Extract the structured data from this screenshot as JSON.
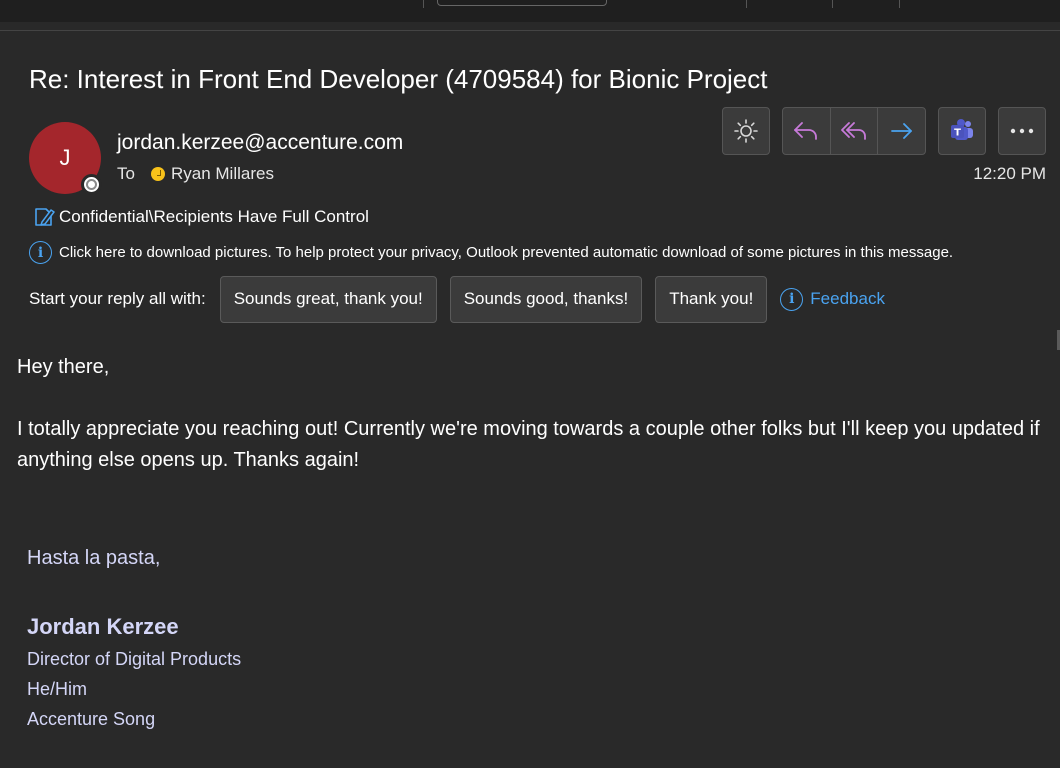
{
  "email": {
    "subject": "Re: Interest in Front End Developer (4709584) for Bionic Project",
    "avatar_initial": "J",
    "sender": "jordan.kerzee@accenture.com",
    "to_label": "To",
    "recipient": "Ryan Millares",
    "time": "12:20 PM",
    "sensitivity_label": "Confidential\\Recipients Have Full Control",
    "picture_notice": "Click here to download pictures. To help protect your privacy, Outlook prevented automatic download of some pictures in this message."
  },
  "toolbar": {
    "theme_icon": "sun-icon",
    "reply_icon": "reply-arrow-icon",
    "reply_all_icon": "reply-all-arrow-icon",
    "forward_icon": "forward-arrow-icon",
    "teams_icon": "teams-icon",
    "more_icon": "more-dots-icon"
  },
  "suggested_replies": {
    "prompt": "Start your reply all with:",
    "options": [
      "Sounds great, thank you!",
      "Sounds good, thanks!",
      "Thank you!"
    ],
    "feedback_label": "Feedback"
  },
  "body": {
    "greeting": "Hey there,",
    "paragraph": "I totally appreciate you reaching out! Currently we're moving towards a couple other folks but I'll keep you updated if anything else opens up. Thanks again!"
  },
  "signature": {
    "closing": "Hasta la pasta,",
    "name": "Jordan Kerzee",
    "title": "Director of Digital Products",
    "pronouns": "He/Him",
    "company": "Accenture Song"
  },
  "colors": {
    "background": "#292929",
    "avatar": "#a4262c",
    "accent_blue": "#4aa3f0",
    "reply_purple": "#c77ad9",
    "signature_text": "#d4d6f7"
  }
}
